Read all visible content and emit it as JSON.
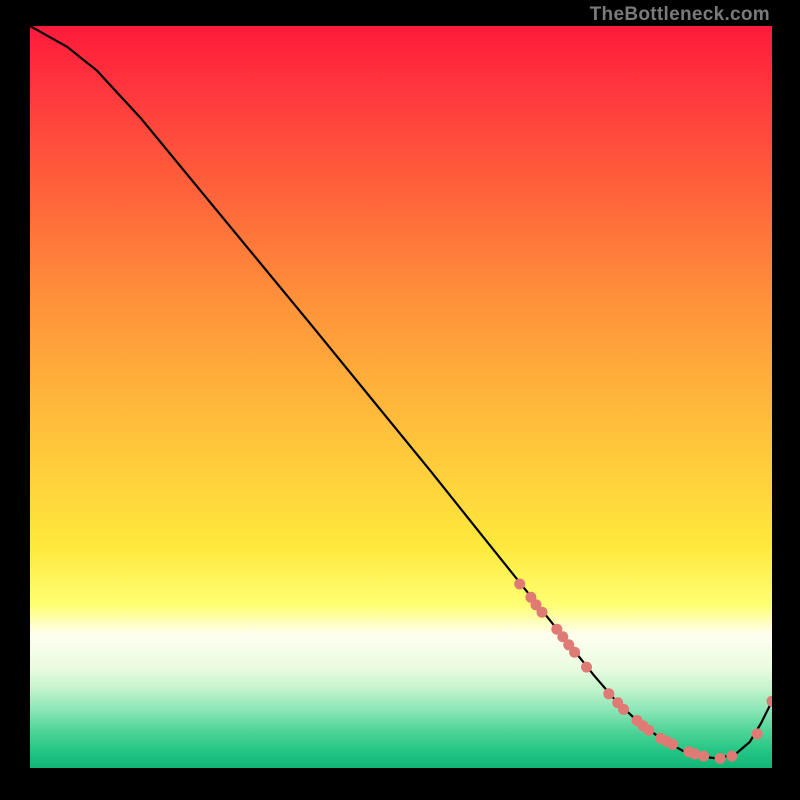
{
  "branding": {
    "text": "TheBottleneck.com"
  },
  "chart_data": {
    "type": "line",
    "title": "",
    "xlabel": "",
    "ylabel": "",
    "xlim": [
      0,
      100
    ],
    "ylim": [
      0,
      100
    ],
    "grid": false,
    "legend": false,
    "series": [
      {
        "name": "curve",
        "x": [
          0,
          5,
          9,
          15,
          22,
          30,
          38,
          46,
          54,
          60,
          66,
          72,
          76,
          79,
          82,
          85,
          88,
          90,
          92.5,
          95,
          97,
          98.5,
          100
        ],
        "y": [
          100,
          97.2,
          94.0,
          87.5,
          79.0,
          69.3,
          59.6,
          49.8,
          40.0,
          32.5,
          25.0,
          17.5,
          12.5,
          9.0,
          6.2,
          4.0,
          2.3,
          1.6,
          1.3,
          1.8,
          3.5,
          6.0,
          9.0
        ]
      }
    ],
    "markers": [
      {
        "name": "cluster-steep",
        "color": "#e07a74",
        "x": [
          66.0,
          67.5,
          68.2,
          69.0,
          71.0,
          71.8,
          72.6,
          73.4,
          75.0
        ],
        "y": [
          24.8,
          23.0,
          22.0,
          21.0,
          18.7,
          17.7,
          16.6,
          15.6,
          13.6
        ]
      },
      {
        "name": "cluster-valley",
        "color": "#e07a74",
        "x": [
          78.0,
          79.2,
          80.0,
          81.8,
          82.6,
          83.4,
          85.0,
          85.8,
          86.6,
          88.8,
          89.6,
          90.8
        ],
        "y": [
          10.0,
          8.8,
          7.9,
          6.4,
          5.7,
          5.1,
          4.0,
          3.6,
          3.2,
          2.2,
          1.9,
          1.6
        ]
      },
      {
        "name": "cluster-rise",
        "color": "#e07a74",
        "x": [
          93.0,
          94.6,
          98.0,
          100.0
        ],
        "y": [
          1.3,
          1.6,
          4.6,
          9.0
        ]
      }
    ],
    "background_gradient": {
      "direction": "vertical",
      "stops": [
        {
          "pos": 0.0,
          "color": "#ff1a3c"
        },
        {
          "pos": 0.25,
          "color": "#ff6b3a"
        },
        {
          "pos": 0.55,
          "color": "#ffc23b"
        },
        {
          "pos": 0.78,
          "color": "#ffff73"
        },
        {
          "pos": 0.82,
          "color": "#fffef0"
        },
        {
          "pos": 0.9,
          "color": "#8fe7b9"
        },
        {
          "pos": 1.0,
          "color": "#11b674"
        }
      ]
    }
  }
}
